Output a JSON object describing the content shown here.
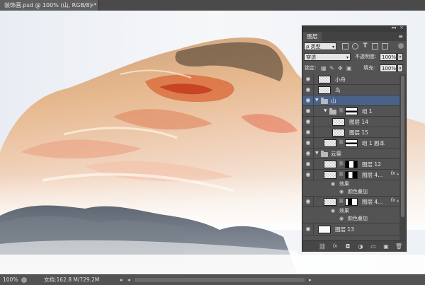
{
  "document": {
    "tab_title": "装饰画.psd @ 100% (山, RGB/8) *",
    "close": "×"
  },
  "status": {
    "zoom": "100%",
    "doc_info": "文档:162.8 M/729.2M",
    "arrow": "▸",
    "left_arrow": "◂",
    "right_arrow": "▸"
  },
  "layers_panel": {
    "tab": "图层",
    "menu_icon": "≡",
    "strip_collapse": "◂◂",
    "strip_close": "×",
    "filter_select": "ρ 类型",
    "filter_icons": [
      "pixel-filter-icon",
      "adjustment-filter-icon",
      "type-filter-icon",
      "shape-filter-icon",
      "smart-object-filter-icon"
    ],
    "type_filter_glyph": "T",
    "blend_mode": "穿透",
    "opacity_label": "不透明度:",
    "opacity_value": "100%",
    "lock_label": "锁定:",
    "fill_label": "填充:",
    "fill_value": "100%",
    "dropdown_caret": "▾",
    "eye": "◉",
    "expand": "▼",
    "collapse": "▶",
    "chain": "⛓",
    "fx": "fx",
    "fx_arrow": "▴",
    "layers": [
      {
        "name": "小舟",
        "type": "layer"
      },
      {
        "name": "鸟",
        "type": "layer"
      },
      {
        "name": "山",
        "type": "group",
        "selected": true
      },
      {
        "name": "组 1",
        "type": "group"
      },
      {
        "name": "图层 14",
        "type": "layer"
      },
      {
        "name": "图层 15",
        "type": "layer"
      },
      {
        "name": "组 1 副本",
        "type": "layer"
      },
      {
        "name": "云雾",
        "type": "group"
      },
      {
        "name": "图层 12",
        "type": "layer"
      },
      {
        "name": "图层 4...",
        "type": "layer",
        "effects": true
      },
      {
        "name": "效果",
        "type": "effect"
      },
      {
        "name": "颜色叠加",
        "type": "effect"
      },
      {
        "name": "图层 4...",
        "type": "layer",
        "effects": true
      },
      {
        "name": "效果",
        "type": "effect"
      },
      {
        "name": "颜色叠加",
        "type": "effect"
      },
      {
        "name": "图层 13",
        "type": "layer"
      }
    ],
    "footer_buttons": [
      "link-layers-icon",
      "fx-icon",
      "add-mask-icon",
      "adjustment-layer-icon",
      "new-group-icon",
      "new-layer-icon",
      "delete-layer-icon"
    ],
    "footer_glyphs": [
      "⛓",
      "fx",
      "◘",
      "◑",
      "▭",
      "▣",
      "🗑"
    ]
  }
}
